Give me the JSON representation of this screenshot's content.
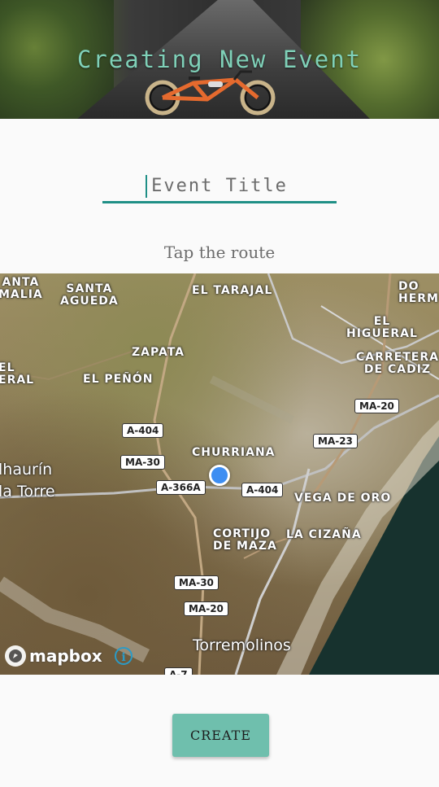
{
  "header": {
    "title": "Creating New Event"
  },
  "form": {
    "title_placeholder": "Event Title",
    "title_value": "",
    "route_label": "Tap the route"
  },
  "map": {
    "places": {
      "santa_amalia": "ANTA\nMALIA",
      "santa_agueda": "SANTA\nAGUEDA",
      "el_tarajal": "EL TARAJAL",
      "do_herm": "DO\nHERM",
      "el_higueral": "EL\nHIGUERAL",
      "carretera_cadiz": "CARRETERA\nDE CADIZ",
      "zapata": "ZAPATA",
      "el_peral": "EL\nERAL",
      "el_penon": "EL PEÑÓN",
      "churriana": "CHURRIANA",
      "alhaurin": "lhaurín\nla Torre",
      "vega_de_oro": "VEGA DE ORO",
      "cortijo_de_maza": "CORTIJO\nDE MAZA",
      "la_cizana": "LA CIZAÑA",
      "torremolinos": "Torremolinos"
    },
    "roads": {
      "a404_top": "A-404",
      "ma30_left": "MA-30",
      "a366a": "A-366A",
      "a404_mid": "A-404",
      "ma23": "MA-23",
      "ma20_right": "MA-20",
      "ma30_bottom": "MA-30",
      "ma20_bottom": "MA-20",
      "a7": "A-7"
    },
    "attribution": "mapbox",
    "info_glyph": "i"
  },
  "actions": {
    "create_label": "CREATE"
  },
  "colors": {
    "accent": "#1f8f86",
    "header_title": "#7fd0b8",
    "create_button": "#6fbfad",
    "location_dot": "#3e8ef2"
  }
}
